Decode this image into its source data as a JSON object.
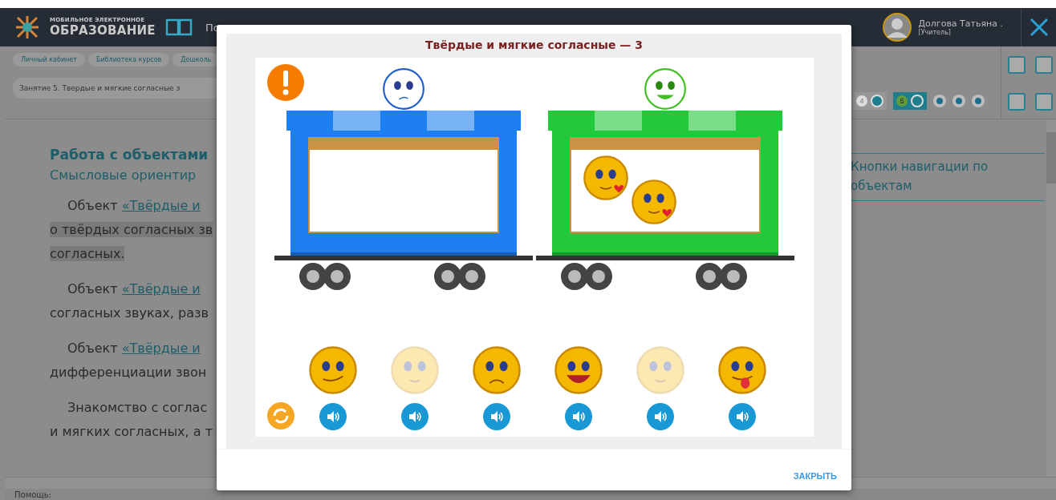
{
  "header": {
    "logo": {
      "line1": "МОБИЛЬНОЕ ЭЛЕКТРОННОЕ",
      "line2": "ОБРАЗОВАНИЕ"
    },
    "nav_items": [
      "По"
    ],
    "user": {
      "name": "Долгова Татьяна .",
      "role": "[Учитель]"
    }
  },
  "breadcrumbs": [
    "Личный кабинет",
    "Библиотека курсов",
    "Дошколь"
  ],
  "lesson_select": {
    "value": "Занятие 5. Твердые и мягкие согласные з"
  },
  "pager": [
    {
      "label": "4",
      "selected": false
    },
    {
      "label": "5",
      "selected": true
    }
  ],
  "content": {
    "heading": "Работа с объектами",
    "subheading": "Смысловые ориентир",
    "paragraphs": [
      {
        "lead": "Объект ",
        "link": "«Твёрдые и",
        "lines": [
          "о твёрдых согласных зв",
          "согласных."
        ],
        "highlighted": true
      },
      {
        "lead": "Объект ",
        "link": "«Твёрдые и",
        "lines": [
          "согласных звуках, разв"
        ],
        "highlighted": false
      },
      {
        "lead": "Объект ",
        "link": "«Твёрдые и",
        "lines": [
          "дифференциации звон"
        ],
        "highlighted": false
      },
      {
        "lead": "Знакомство с соглас",
        "lines": [
          "и мягких согласных, а т"
        ],
        "highlighted": false
      }
    ]
  },
  "side_note": "Кнопки навигации по объектам",
  "status": {
    "help_label": "Помощь:"
  },
  "modal": {
    "title": "Твёрдые и мягкие согласные — 3",
    "wagons": [
      {
        "color": "#1e7ff0",
        "kind": "sad"
      },
      {
        "color": "#22c93a",
        "kind": "happy",
        "passengers": [
          {
            "kind": "love"
          },
          {
            "kind": "love"
          }
        ]
      }
    ],
    "tray": [
      {
        "kind": "smirk",
        "faded": false
      },
      {
        "kind": "blush",
        "faded": true
      },
      {
        "kind": "worried",
        "faded": false
      },
      {
        "kind": "grin",
        "faded": false
      },
      {
        "kind": "blush",
        "faded": true
      },
      {
        "kind": "tongue",
        "faded": false
      }
    ],
    "close_button": "ЗАКРЫТЬ"
  }
}
